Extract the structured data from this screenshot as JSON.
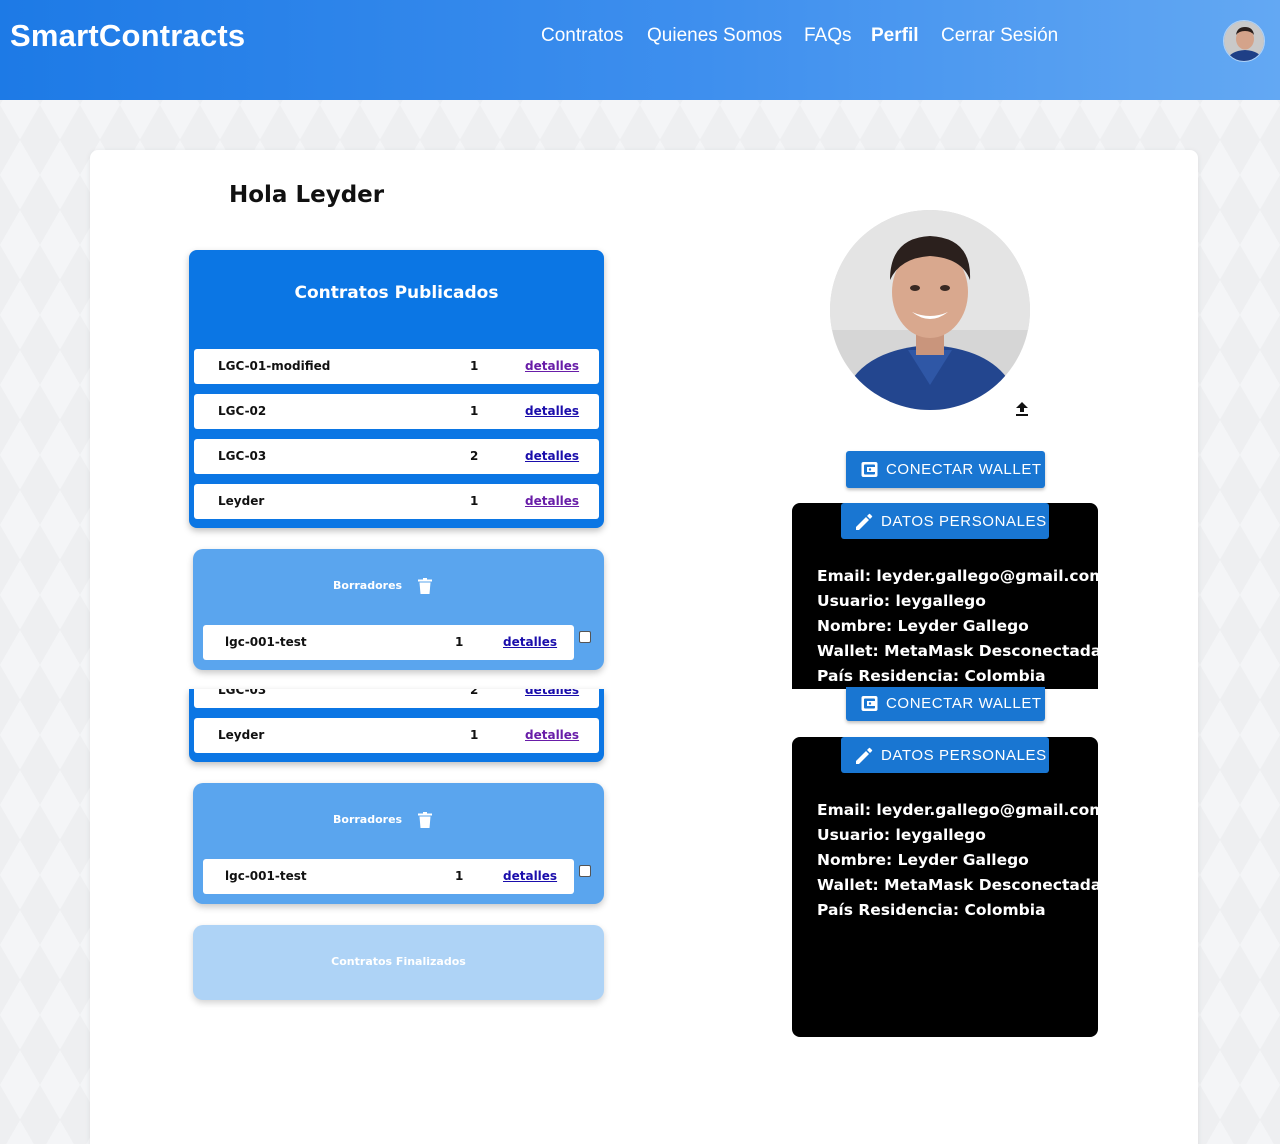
{
  "header": {
    "brand": "SmartContracts",
    "nav": [
      {
        "label": "Contratos",
        "active": false
      },
      {
        "label": "Quienes Somos",
        "active": false
      },
      {
        "label": "FAQs",
        "active": false
      },
      {
        "label": "Perfil",
        "active": true
      },
      {
        "label": "Cerrar Sesión",
        "active": false
      }
    ]
  },
  "greeting": "Hola Leyder",
  "published": {
    "title": "Contratos Publicados",
    "rows": [
      {
        "name": "LGC-01-modified",
        "count": "1",
        "link": "detalles"
      },
      {
        "name": "LGC-02",
        "count": "1",
        "link": "detalles"
      },
      {
        "name": "LGC-03",
        "count": "2",
        "link": "detalles"
      },
      {
        "name": "Leyder",
        "count": "1",
        "link": "detalles"
      }
    ]
  },
  "drafts": {
    "title": "Borradores",
    "rows": [
      {
        "name": "lgc-001-test",
        "count": "1",
        "link": "detalles"
      }
    ]
  },
  "finalized": {
    "title": "Contratos Finalizados"
  },
  "profile": {
    "connect_wallet_label": "CONECTAR WALLET",
    "personal_data_label": "DATOS PERSONALES",
    "email": "Email: leyder.gallego@gmail.com",
    "user": "Usuario: leygallego",
    "name": "Nombre: Leyder Gallego",
    "wallet": "Wallet: MetaMask Desconectada",
    "country": "País Residencia: Colombia"
  },
  "colors": {
    "header_start": "#1d7ae6",
    "header_end": "#63a8f3",
    "published_panel": "#0b76e4",
    "drafts_panel": "#5aa5ee",
    "finalized_panel": "#aed3f6",
    "button": "#1976d2"
  },
  "icons": [
    "trash-icon",
    "upload-icon",
    "wallet-icon",
    "pencil-icon"
  ]
}
